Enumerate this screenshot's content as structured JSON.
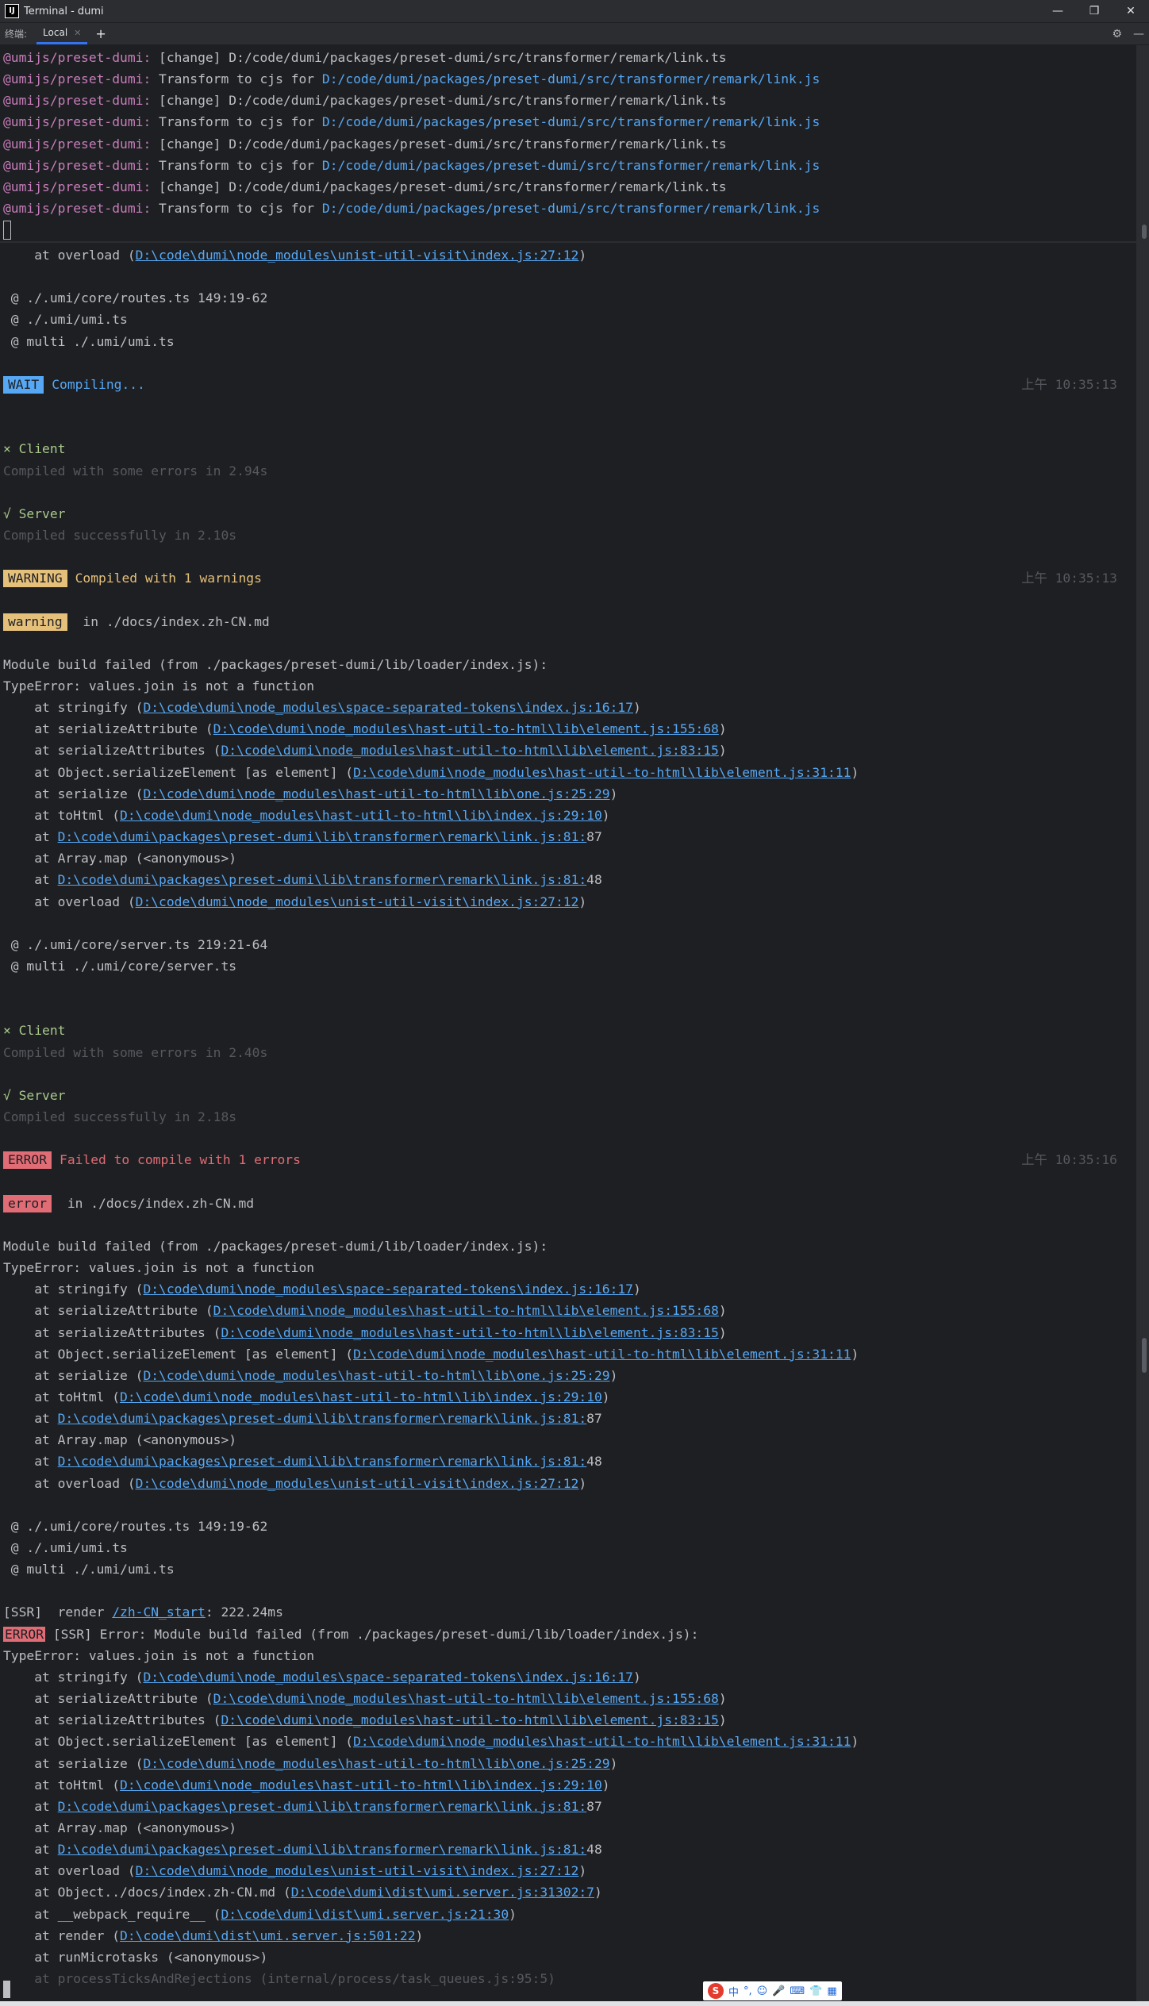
{
  "window": {
    "title": "Terminal - dumi",
    "app_icon": "IJ"
  },
  "tabbar": {
    "prefix": "终端:",
    "tab_label": "Local"
  },
  "pane1": [
    {
      "pkg": "@umijs/preset-dumi:",
      "rest": " [change] D:/code/dumi/packages/preset-dumi/src/transformer/remark/link.ts",
      "link": ""
    },
    {
      "pkg": "@umijs/preset-dumi:",
      "rest": " Transform to cjs for ",
      "link": "D:/code/dumi/packages/preset-dumi/src/transformer/remark/link.js"
    },
    {
      "pkg": "@umijs/preset-dumi:",
      "rest": " [change] D:/code/dumi/packages/preset-dumi/src/transformer/remark/link.ts",
      "link": ""
    },
    {
      "pkg": "@umijs/preset-dumi:",
      "rest": " Transform to cjs for ",
      "link": "D:/code/dumi/packages/preset-dumi/src/transformer/remark/link.js"
    },
    {
      "pkg": "@umijs/preset-dumi:",
      "rest": " [change] D:/code/dumi/packages/preset-dumi/src/transformer/remark/link.ts",
      "link": ""
    },
    {
      "pkg": "@umijs/preset-dumi:",
      "rest": " Transform to cjs for ",
      "link": "D:/code/dumi/packages/preset-dumi/src/transformer/remark/link.js"
    },
    {
      "pkg": "@umijs/preset-dumi:",
      "rest": " [change] D:/code/dumi/packages/preset-dumi/src/transformer/remark/link.ts",
      "link": ""
    },
    {
      "pkg": "@umijs/preset-dumi:",
      "rest": " Transform to cjs for ",
      "link": "D:/code/dumi/packages/preset-dumi/src/transformer/remark/link.js"
    }
  ],
  "pane2": {
    "top_overload": {
      "pre": "    at overload (",
      "file": "D:\\code\\dumi\\node_modules\\unist-util-visit\\index.js:27:12",
      "post": ")"
    },
    "routes1": [
      " @ ./.umi/core/routes.ts 149:19-62",
      " @ ./.umi/umi.ts",
      " @ multi ./.umi/umi.ts"
    ],
    "wait": {
      "tag": "WAIT",
      "msg": "Compiling...",
      "time": "上午 10:35:13"
    },
    "client1": {
      "mark": "× Client",
      "detail": "Compiled with some errors in 2.94s"
    },
    "server1": {
      "mark": "√ Server",
      "detail": "Compiled successfully in 2.10s"
    },
    "warning_header": {
      "tag": "WARNING",
      "msg": "Compiled with 1 warnings",
      "time": "上午 10:35:13"
    },
    "warning_sub": {
      "tag": "warning",
      "msg": " in ./docs/index.zh-CN.md"
    },
    "module_build": "Module build failed (from ./packages/preset-dumi/lib/loader/index.js):",
    "type_error": "TypeError: values.join is not a function",
    "stack": [
      {
        "pre": "    at stringify (",
        "file": "D:\\code\\dumi\\node_modules\\space-separated-tokens\\index.js:16:17",
        "post": ")"
      },
      {
        "pre": "    at serializeAttribute (",
        "file": "D:\\code\\dumi\\node_modules\\hast-util-to-html\\lib\\element.js:155:68",
        "post": ")"
      },
      {
        "pre": "    at serializeAttributes (",
        "file": "D:\\code\\dumi\\node_modules\\hast-util-to-html\\lib\\element.js:83:15",
        "post": ")"
      },
      {
        "pre": "    at Object.serializeElement [as element] (",
        "file": "D:\\code\\dumi\\node_modules\\hast-util-to-html\\lib\\element.js:31:11",
        "post": ")"
      },
      {
        "pre": "    at serialize (",
        "file": "D:\\code\\dumi\\node_modules\\hast-util-to-html\\lib\\one.js:25:29",
        "post": ")"
      },
      {
        "pre": "    at toHtml (",
        "file": "D:\\code\\dumi\\node_modules\\hast-util-to-html\\lib\\index.js:29:10",
        "post": ")"
      },
      {
        "pre": "    at ",
        "file": "D:\\code\\dumi\\packages\\preset-dumi\\lib\\transformer\\remark\\link.js:81:",
        "post": "87"
      },
      {
        "pre": "    at Array.map (<anonymous>)",
        "file": "",
        "post": ""
      },
      {
        "pre": "    at ",
        "file": "D:\\code\\dumi\\packages\\preset-dumi\\lib\\transformer\\remark\\link.js:81:",
        "post": "48"
      },
      {
        "pre": "    at overload (",
        "file": "D:\\code\\dumi\\node_modules\\unist-util-visit\\index.js:27:12",
        "post": ")"
      }
    ],
    "server_refs": [
      " @ ./.umi/core/server.ts 219:21-64",
      " @ multi ./.umi/core/server.ts"
    ],
    "client2": {
      "mark": "× Client",
      "detail": "Compiled with some errors in 2.40s"
    },
    "server2": {
      "mark": "√ Server",
      "detail": "Compiled successfully in 2.18s"
    },
    "error_header": {
      "tag": "ERROR",
      "msg": "Failed to compile with 1 errors",
      "time": "上午 10:35:16"
    },
    "error_sub": {
      "tag": "error",
      "msg": " in ./docs/index.zh-CN.md"
    },
    "routes2": [
      " @ ./.umi/core/routes.ts 149:19-62",
      " @ ./.umi/umi.ts",
      " @ multi ./.umi/umi.ts"
    ],
    "ssr_render": {
      "pre": "[SSR]  render ",
      "link": "/zh-CN_start",
      "post": ": 222.24ms"
    },
    "ssr_error": {
      "tag": "ERROR",
      "msg": " [SSR] Error: Module build failed (from ./packages/preset-dumi/lib/loader/index.js):"
    },
    "ssr_extra": [
      {
        "pre": "    at Object../docs/index.zh-CN.md (",
        "file": "D:\\code\\dumi\\dist\\umi.server.js:31302:7",
        "post": ")"
      },
      {
        "pre": "    at __webpack_require__ (",
        "file": "D:\\code\\dumi\\dist\\umi.server.js:21:30",
        "post": ")"
      },
      {
        "pre": "    at render (",
        "file": "D:\\code\\dumi\\dist\\umi.server.js:501:22",
        "post": ")"
      },
      {
        "pre": "    at runMicrotasks (<anonymous>)",
        "file": "",
        "post": ""
      }
    ],
    "last_line": "    at processTicksAndRejections (internal/process/task_queues.js:95:5)"
  },
  "ime": {
    "label": "中",
    "items": [
      "°,",
      "☺",
      "🎤",
      "⌨",
      "👕",
      "▦"
    ]
  },
  "colors": {
    "bg": "#1e1f22",
    "pkg": "#c77dbb",
    "link": "#56a8f5",
    "error": "#e06c75",
    "warning": "#e5c07b",
    "green": "#a8c98c"
  }
}
